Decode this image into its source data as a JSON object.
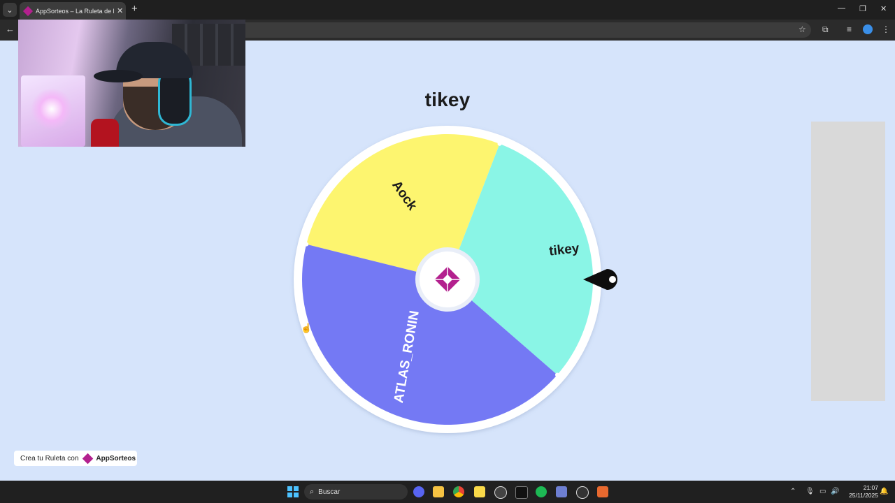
{
  "browser": {
    "tab_title": "AppSorteos – La Ruleta de la Suerte",
    "new_tab_label": "+",
    "close_label": "✕"
  },
  "page": {
    "winner_name": "tikey",
    "wheel_segments": [
      {
        "label": "Aock",
        "color": "#fdf56f"
      },
      {
        "label": "tikey",
        "color": "#8af5e6"
      },
      {
        "label": "ATLAS_RONIN",
        "color": "#7479f4"
      }
    ],
    "promo_text": "Crea tu Ruleta con",
    "promo_brand": "AppSorteos"
  },
  "taskbar": {
    "search_label": "Buscar",
    "time": "21:07",
    "date": "25/11/2025"
  },
  "colors": {
    "page_bg": "#d6e4fb",
    "brand": "#b3208e"
  }
}
